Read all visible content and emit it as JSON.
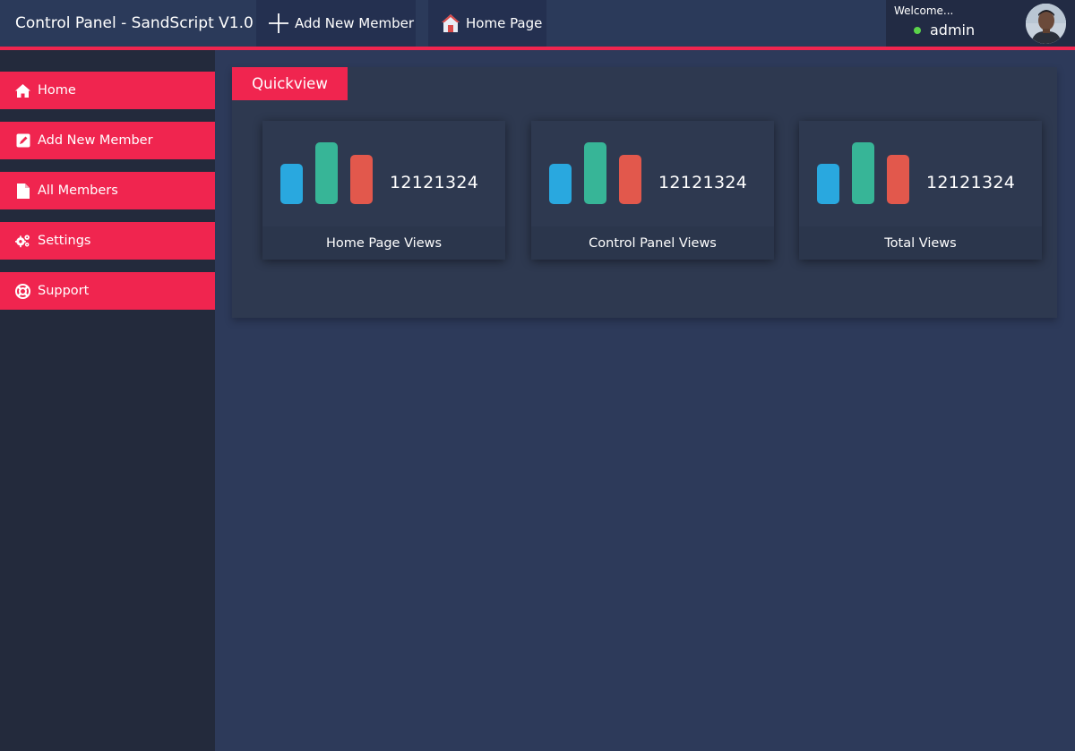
{
  "app": {
    "title": "Control Panel - SandScript V1.0"
  },
  "topnav": {
    "add_member_label": "Add New Member",
    "home_page_label": "Home Page"
  },
  "user": {
    "welcome_text": "Welcome...",
    "username": "admin",
    "status_color": "#5bd34a"
  },
  "sidebar": {
    "items": [
      {
        "label": "Home",
        "icon": "home-icon"
      },
      {
        "label": "Add New Member",
        "icon": "edit-icon"
      },
      {
        "label": "All Members",
        "icon": "file-icon"
      },
      {
        "label": "Settings",
        "icon": "gears-icon"
      },
      {
        "label": "Support",
        "icon": "lifebuoy-icon"
      }
    ]
  },
  "quickview": {
    "title": "Quickview",
    "cards": [
      {
        "value": "12121324",
        "label": "Home Page Views"
      },
      {
        "value": "12121324",
        "label": "Control Panel Views"
      },
      {
        "value": "12121324",
        "label": "Total Views"
      }
    ]
  },
  "colors": {
    "accent": "#f0254f",
    "bar_blue": "#29a8df",
    "bar_teal": "#37b597",
    "bar_red": "#e2584c"
  }
}
